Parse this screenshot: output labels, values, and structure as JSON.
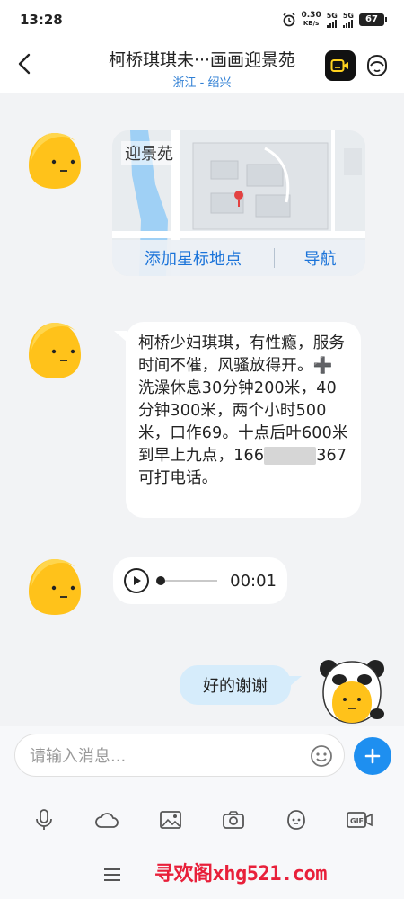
{
  "status_bar": {
    "time": "13:28",
    "net_speed": "0.30",
    "net_unit": "KB/s",
    "signal1": "5G",
    "signal2": "5G",
    "battery": "67"
  },
  "header": {
    "title": "柯桥琪琪未···画画迎景苑",
    "subtitle": "浙江 - 绍兴",
    "back_icon": "chevron-left-icon",
    "video_icon": "video-call-icon",
    "profile_icon": "profile-icon"
  },
  "messages": {
    "map": {
      "title": "迎景苑",
      "star_label": "添加星标地点",
      "nav_label": "导航"
    },
    "text": {
      "part1": "柯桥少妇琪琪，有性瘾，服务时间不催，风骚放得开。➕洗澡休息30分钟200米，40分钟300米，两个小时500米，口作69。十点后叶600米到早上九点，166",
      "part2": "367可打电话。"
    },
    "voice": {
      "duration": "00:01"
    },
    "reply": {
      "text": "好的谢谢"
    }
  },
  "composer": {
    "placeholder": "请输入消息...",
    "tools": [
      "microphone-icon",
      "cloud-icon",
      "image-icon",
      "camera-icon",
      "emoji-icon",
      "gif-icon"
    ]
  },
  "watermark": "寻欢阁xhg521.com",
  "colors": {
    "accent": "#1e8ff0",
    "link": "#1a73d9",
    "reply_bubble": "#d6ecfb",
    "avatar_yellow": "#ffc21a"
  }
}
